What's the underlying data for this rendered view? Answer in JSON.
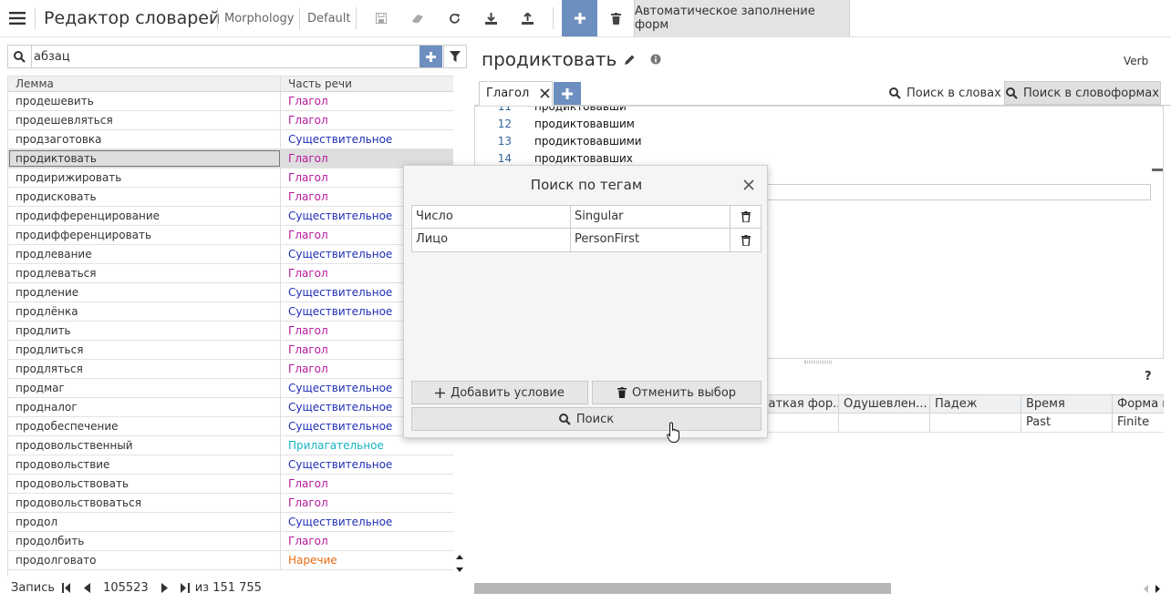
{
  "app": {
    "title": "Редактор словарей",
    "crumb1": "Morphology",
    "crumb2": "Default",
    "autofill": "Автоматическое заполнение форм"
  },
  "search": {
    "value": "абзац"
  },
  "lemmas": {
    "headers": {
      "lemma": "Лемма",
      "pos": "Часть речи"
    },
    "rows": [
      {
        "lemma": "продешевить",
        "pos": "Глагол",
        "color": "#b5179e"
      },
      {
        "lemma": "продешевляться",
        "pos": "Глагол",
        "color": "#b5179e"
      },
      {
        "lemma": "продзаготовка",
        "pos": "Существительное",
        "color": "#1f2fb5"
      },
      {
        "lemma": "продиктовать",
        "pos": "Глагол",
        "color": "#b5179e",
        "selected": true
      },
      {
        "lemma": "продирижировать",
        "pos": "Глагол",
        "color": "#b5179e"
      },
      {
        "lemma": "продисковать",
        "pos": "Глагол",
        "color": "#b5179e"
      },
      {
        "lemma": "продифференцирование",
        "pos": "Существительное",
        "color": "#1f2fb5"
      },
      {
        "lemma": "продифференцировать",
        "pos": "Глагол",
        "color": "#b5179e"
      },
      {
        "lemma": "продлевание",
        "pos": "Существительное",
        "color": "#1f2fb5"
      },
      {
        "lemma": "продлеваться",
        "pos": "Глагол",
        "color": "#b5179e"
      },
      {
        "lemma": "продление",
        "pos": "Существительное",
        "color": "#1f2fb5"
      },
      {
        "lemma": "продлёнка",
        "pos": "Существительное",
        "color": "#1f2fb5"
      },
      {
        "lemma": "продлить",
        "pos": "Глагол",
        "color": "#b5179e"
      },
      {
        "lemma": "продлиться",
        "pos": "Глагол",
        "color": "#b5179e"
      },
      {
        "lemma": "продляться",
        "pos": "Глагол",
        "color": "#b5179e"
      },
      {
        "lemma": "продмаг",
        "pos": "Существительное",
        "color": "#1f2fb5"
      },
      {
        "lemma": "продналог",
        "pos": "Существительное",
        "color": "#1f2fb5"
      },
      {
        "lemma": "продобеспечение",
        "pos": "Существительное",
        "color": "#1f2fb5"
      },
      {
        "lemma": "продовольственный",
        "pos": "Прилагательное",
        "color": "#17b3c4"
      },
      {
        "lemma": "продовольствие",
        "pos": "Существительное",
        "color": "#1f2fb5"
      },
      {
        "lemma": "продовольствовать",
        "pos": "Глагол",
        "color": "#b5179e"
      },
      {
        "lemma": "продовольствоваться",
        "pos": "Глагол",
        "color": "#b5179e"
      },
      {
        "lemma": "продол",
        "pos": "Существительное",
        "color": "#1f2fb5"
      },
      {
        "lemma": "продолбить",
        "pos": "Глагол",
        "color": "#b5179e"
      },
      {
        "lemma": "продолговато",
        "pos": "Наречие",
        "color": "#e86a10"
      }
    ]
  },
  "status": {
    "label": "Запись",
    "record": "105523",
    "total": "из 151 755"
  },
  "word": {
    "title": "продиктовать",
    "pos_tag": "Verb"
  },
  "tabs": {
    "active": "Глагол",
    "search_words": "Поиск в словах",
    "search_forms": "Поиск в словоформах"
  },
  "editor": {
    "lines": [
      {
        "num": "11",
        "text": "продиктовавши"
      },
      {
        "num": "12",
        "text": "продиктовавшим"
      },
      {
        "num": "13",
        "text": "продиктовавшими"
      },
      {
        "num": "14",
        "text": "продиктовавших"
      }
    ]
  },
  "grid": {
    "help": "?",
    "headers": [
      "",
      "",
      "",
      "Краткая фор...",
      "Одушевлен...",
      "Падеж",
      "Время",
      "Форма г"
    ],
    "row": [
      "",
      "",
      "",
      "",
      "",
      "",
      "Past",
      "Finite"
    ]
  },
  "modal": {
    "title": "Поиск по тегам",
    "conditions": [
      {
        "key": "Число",
        "value": "Singular"
      },
      {
        "key": "Лицо",
        "value": "PersonFirst"
      }
    ],
    "add_label": "Добавить условие",
    "cancel_label": "Отменить выбор",
    "search_label": "Поиск"
  }
}
